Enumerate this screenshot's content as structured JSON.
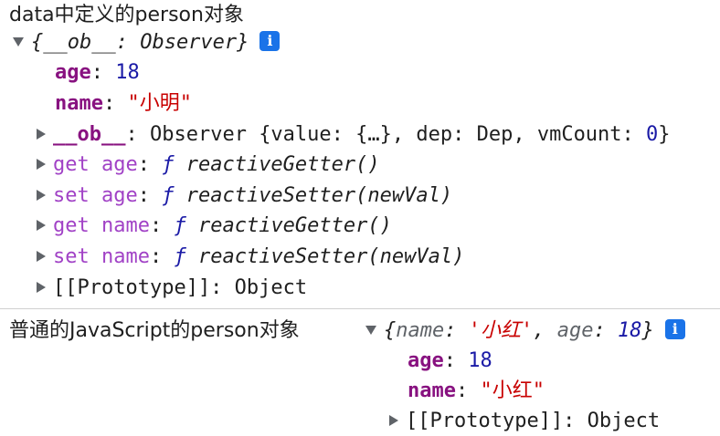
{
  "section1": {
    "title": "data中定义的person对象",
    "summary": "{__ob__: Observer}",
    "props": [
      {
        "key": "age",
        "value": "18"
      },
      {
        "key": "name",
        "value": "\"小明\""
      }
    ],
    "ob_row": {
      "key": "__ob__",
      "value": "Observer {value: {…}, dep: Dep, vmCount: 0}",
      "value_head": "Observer {value: {…}, dep: Dep, vmCount: ",
      "value_num": "0",
      "value_tail": "}"
    },
    "accessors": [
      {
        "label": "get age",
        "f": "ƒ",
        "sig": "reactiveGetter()"
      },
      {
        "label": "set age",
        "f": "ƒ",
        "sig": "reactiveSetter(newVal)"
      },
      {
        "label": "get name",
        "f": "ƒ",
        "sig": "reactiveGetter()"
      },
      {
        "label": "set name",
        "f": "ƒ",
        "sig": "reactiveSetter(newVal)"
      }
    ],
    "prototype": "[[Prototype]]: Object"
  },
  "section2": {
    "title": "普通的JavaScript的person对象",
    "summary": "{name: '小红', age: 18}",
    "summary_parts": {
      "open": "{",
      "name_key": "name",
      "name_val": "'小红'",
      "age_key": "age",
      "age_val": "18",
      "close": "}"
    },
    "props": [
      {
        "key": "age",
        "value": "18"
      },
      {
        "key": "name",
        "value": "\"小红\""
      }
    ],
    "prototype": "[[Prototype]]: Object"
  },
  "colors": {
    "key": "#881280",
    "accessor": "#a142c6",
    "number": "#1a1aa6",
    "string": "#c80000",
    "info_icon_bg": "#1a73e8"
  }
}
